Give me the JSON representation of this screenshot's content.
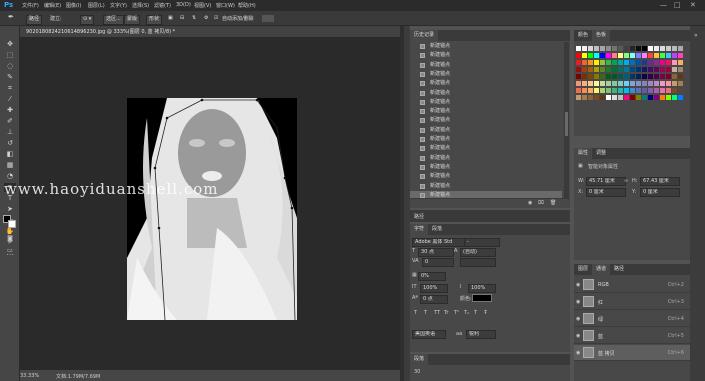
{
  "app": {
    "logo": "Ps"
  },
  "menu": [
    "文件(F)",
    "编辑(E)",
    "图像(I)",
    "图层(L)",
    "文字(Y)",
    "选择(S)",
    "滤镜(T)",
    "3D(D)",
    "视图(V)",
    "窗口(W)",
    "帮助(H)"
  ],
  "window_controls": [
    "—",
    "□",
    "✕"
  ],
  "options_bar": {
    "shape_mode": "路径",
    "make_label": "建立:",
    "selection_btn": "选区...",
    "mask_btn": "蒙版",
    "shape_btn": "形状",
    "auto_add_delete": "自动添加/删除"
  },
  "document": {
    "tab_title": "9020180824210614896230.jpg @ 333%(图层 0, 蓝 拷贝/8) *",
    "zoom": "33.33%",
    "doc_info": "文档:1.79M/7.69M",
    "watermark": "www.haoyiduanshell.com"
  },
  "history": {
    "tabs": [
      "历史记录"
    ],
    "items": [
      "新建锚点",
      "新建锚点",
      "新建锚点",
      "新建锚点",
      "新建锚点",
      "新建锚点",
      "新建锚点",
      "新建锚点",
      "新建锚点",
      "新建锚点",
      "新建锚点",
      "新建锚点",
      "新建锚点",
      "新建锚点",
      "新建锚点",
      "新建锚点",
      "新建锚点"
    ],
    "active_index": 16
  },
  "paths_group": {
    "label": "路径"
  },
  "character": {
    "tabs": [
      "字符",
      "段落"
    ],
    "font_family": "Adobe 黑体 Std",
    "font_style": "-",
    "font_size": "30 点",
    "leading": "(自动)",
    "kerning": "0",
    "tracking": "0%",
    "vscale": "100%",
    "hscale": "100%",
    "baseline": "0 点",
    "color_label": "颜色:",
    "language": "美国英语",
    "aa": "锐利",
    "style_buttons": [
      "T",
      "T",
      "TT",
      "Tr",
      "T¹",
      "T₁",
      "T",
      "Ŧ"
    ],
    "accent": "#000000"
  },
  "paragraph": {
    "tabs": [
      "段落"
    ],
    "value": "30"
  },
  "color": {
    "tabs": [
      "颜色",
      "色板"
    ]
  },
  "properties": {
    "tabs": [
      "属性",
      "调整"
    ],
    "title": "智能对象属性",
    "w_label": "W:",
    "w_value": "45.71 厘米",
    "h_label": "H:",
    "h_value": "67.43 厘米",
    "x_label": "X:",
    "x_value": "0 厘米",
    "y_label": "Y:",
    "y_value": "0 厘米"
  },
  "layers": {
    "tabs": [
      "图层",
      "通道",
      "路径"
    ],
    "rows": [
      {
        "name": "RGB",
        "shortcut": "Ctrl+2"
      },
      {
        "name": "红",
        "shortcut": "Ctrl+3"
      },
      {
        "name": "绿",
        "shortcut": "Ctrl+4"
      },
      {
        "name": "蓝",
        "shortcut": "Ctrl+5"
      },
      {
        "name": "蓝 拷贝",
        "shortcut": "Ctrl+6"
      }
    ],
    "active_index": 4
  }
}
